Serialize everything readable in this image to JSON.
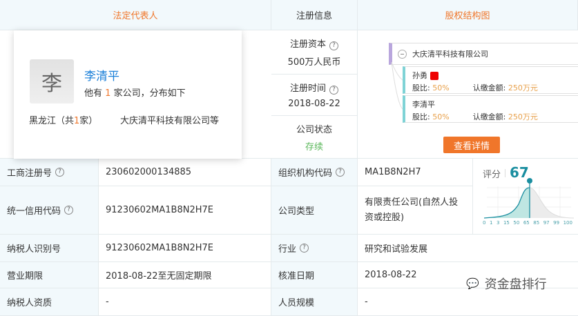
{
  "headers": {
    "legal_rep": "法定代表人",
    "reg_info": "注册信息",
    "equity": "股权结构图"
  },
  "reg": {
    "capital_label": "注册资本",
    "capital_value": "500万人民币",
    "time_label": "注册时间",
    "time_value": "2018-08-22",
    "status_label": "公司状态",
    "status_value": "存续"
  },
  "popup": {
    "avatar_char": "李",
    "name": "李清平",
    "desc_pre": "他有",
    "desc_count": "1",
    "desc_post": "家公司，分布如下",
    "region_pre": "黑龙江（共",
    "region_count": "1",
    "region_post": "家）",
    "companies": "大庆清平科技有限公司等"
  },
  "equity": {
    "company": "大庆清平科技有限公司",
    "holders": [
      {
        "name": "孙勇",
        "ratio_label": "股比:",
        "ratio": "50%",
        "amount_label": "认缴金额:",
        "amount": "250万元"
      },
      {
        "name": "李清平",
        "ratio_label": "股比:",
        "ratio": "50%",
        "amount_label": "认缴金额:",
        "amount": "250万元"
      }
    ],
    "detail_button": "查看详情"
  },
  "score": {
    "label": "评分",
    "value": "67",
    "ticks": [
      "0",
      "1",
      "3",
      "15",
      "50",
      "65",
      "85",
      "97",
      "99",
      "100"
    ]
  },
  "rows": [
    {
      "l1": "工商注册号",
      "v1": "230602000134885",
      "l2": "组织机构代码",
      "v2": "MA1B8N2H7"
    },
    {
      "l1": "统一信用代码",
      "v1": "91230602MA1B8N2H7E",
      "l2": "公司类型",
      "v2": "有限责任公司(自然人投资或控股)"
    },
    {
      "l1": "纳税人识别号",
      "v1": "91230602MA1B8N2H7E",
      "l2": "行业",
      "v2": "研究和试验发展"
    },
    {
      "l1": "营业期限",
      "v1": "2018-08-22至无固定期限",
      "l2": "核准日期",
      "v2": "2018-08-22"
    },
    {
      "l1": "纳税人资质",
      "v1": "-",
      "l2": "人员规模",
      "v2": "-"
    }
  ],
  "watermark": "资金盘排行",
  "colors": {
    "accent_orange": "#f0762a",
    "blue": "#1a7fd8",
    "teal": "#1a8ea0",
    "green": "#5cb85c"
  }
}
